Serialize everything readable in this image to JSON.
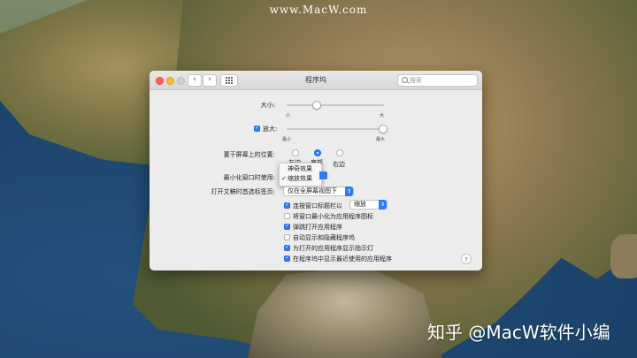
{
  "watermarks": {
    "top": "www.MacW.com",
    "bottom": "知乎 @MacW软件小编"
  },
  "window": {
    "title": "程序坞",
    "search_placeholder": "搜索",
    "nav_back": "‹",
    "nav_forward": "›",
    "help": "?"
  },
  "size": {
    "label": "大小:",
    "min": "小",
    "max": "大",
    "value_fraction": 0.3
  },
  "magnification": {
    "label": "放大:",
    "checked": true,
    "min": "最小",
    "max": "最大",
    "value_fraction": 0.98
  },
  "position": {
    "label": "置于屏幕上的位置:",
    "options": [
      "左边",
      "底部",
      "右边"
    ],
    "selected": "底部"
  },
  "minimize": {
    "label": "最小化窗口时使用:",
    "menu_items": [
      {
        "label": "神奇效果",
        "checked": false
      },
      {
        "label": "缩放效果",
        "checked": true
      }
    ]
  },
  "tabs": {
    "label": "打开文稿时首选标签页:",
    "value": "仅在全屏幕视图下"
  },
  "checkboxes": [
    {
      "label": "连按窗口标题栏以",
      "checked": true,
      "popup": "缩放"
    },
    {
      "label": "将窗口最小化为应用程序图标",
      "checked": false
    },
    {
      "label": "弹跳打开应用程序",
      "checked": true
    },
    {
      "label": "自动显示和隐藏程序坞",
      "checked": false
    },
    {
      "label": "为打开的应用程序显示指示灯",
      "checked": true
    },
    {
      "label": "在程序坞中显示最近使用的应用程序",
      "checked": true
    }
  ],
  "colors": {
    "accent": "#2d7cf6",
    "window_bg": "#ececec"
  }
}
